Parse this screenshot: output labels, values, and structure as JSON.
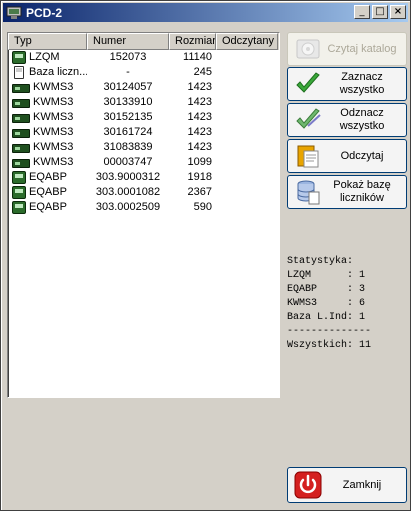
{
  "window": {
    "title": "PCD-2"
  },
  "titlebar_buttons": {
    "minimize": "_",
    "maximize": "□",
    "close": "×"
  },
  "columns": [
    "Typ",
    "Numer",
    "Rozmiar",
    "Odczytany"
  ],
  "rows": [
    {
      "icon": "meter-icon",
      "typ": "LZQM",
      "numer": "152073",
      "rozmiar": "11140",
      "odczytany": ""
    },
    {
      "icon": "database-icon",
      "typ": "Baza liczn...",
      "numer": "-",
      "rozmiar": "245",
      "odczytany": ""
    },
    {
      "icon": "kwms-icon",
      "typ": "KWMS3",
      "numer": "30124057",
      "rozmiar": "1423",
      "odczytany": ""
    },
    {
      "icon": "kwms-icon",
      "typ": "KWMS3",
      "numer": "30133910",
      "rozmiar": "1423",
      "odczytany": ""
    },
    {
      "icon": "kwms-icon",
      "typ": "KWMS3",
      "numer": "30152135",
      "rozmiar": "1423",
      "odczytany": ""
    },
    {
      "icon": "kwms-icon",
      "typ": "KWMS3",
      "numer": "30161724",
      "rozmiar": "1423",
      "odczytany": ""
    },
    {
      "icon": "kwms-icon",
      "typ": "KWMS3",
      "numer": "31083839",
      "rozmiar": "1423",
      "odczytany": ""
    },
    {
      "icon": "kwms-icon",
      "typ": "KWMS3",
      "numer": "00003747",
      "rozmiar": "1099",
      "odczytany": ""
    },
    {
      "icon": "meter-icon",
      "typ": "EQABP",
      "numer": "303.9000312",
      "rozmiar": "1918",
      "odczytany": ""
    },
    {
      "icon": "meter-icon",
      "typ": "EQABP",
      "numer": "303.0001082",
      "rozmiar": "2367",
      "odczytany": ""
    },
    {
      "icon": "meter-icon",
      "typ": "EQABP",
      "numer": "303.0002509",
      "rozmiar": "590",
      "odczytany": ""
    }
  ],
  "buttons": {
    "read_catalog": "Czytaj katalog",
    "select_all": "Zaznacz wszystko",
    "deselect_all": "Odznacz wszystko",
    "read": "Odczytaj",
    "show_base": "Pokaż bazę liczników",
    "close": "Zamknij"
  },
  "stats": {
    "title": "Statystyka:",
    "lines": [
      "LZQM      : 1",
      "EQABP     : 3",
      "KWMS3     : 6",
      "Baza L.Ind: 1",
      "--------------",
      "Wszystkich: 11"
    ]
  },
  "colors": {
    "titlebar_start": "#0a246a",
    "titlebar_end": "#a6caf0",
    "check_green": "#3aa83a",
    "close_red": "#d42020"
  }
}
